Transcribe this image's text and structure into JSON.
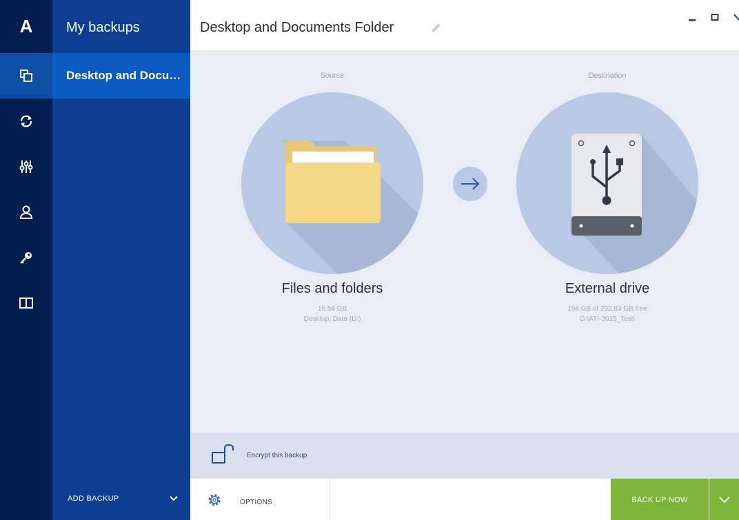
{
  "app": {
    "logo": "A"
  },
  "rail": {
    "items": [
      {
        "icon": "backup-icon",
        "active": true
      },
      {
        "icon": "sync-icon",
        "active": false
      },
      {
        "icon": "tools-icon",
        "active": false
      },
      {
        "icon": "account-icon",
        "active": false
      },
      {
        "icon": "key-icon",
        "active": false
      },
      {
        "icon": "book-icon",
        "active": false
      }
    ]
  },
  "sidebar": {
    "title": "My backups",
    "items": [
      {
        "label": "Desktop and Documents Folder"
      }
    ],
    "add_backup": "ADD BACKUP"
  },
  "header": {
    "title": "Desktop and Documents Folder",
    "controls": [
      "minimize-icon",
      "maximize-icon",
      "close-icon"
    ]
  },
  "source": {
    "heading": "Source",
    "title": "Files and folders",
    "size": "16.54 GB",
    "details": "Desktop, Data (D:)"
  },
  "destination": {
    "heading": "Destination",
    "title": "External drive",
    "space": "194 GB of 232.83 GB free",
    "path": "G:\\ATI-2015_Test\\"
  },
  "encrypt": {
    "label": "Encrypt this backup"
  },
  "toolbar": {
    "options": "OPTIONS",
    "backup_now": "BACK UP NOW"
  },
  "colors": {
    "rail": "#021d4f",
    "sidebar": "#0a3f94",
    "sidebar_active": "#0b5bc2",
    "accent_green": "#7cb53a",
    "circle": "#b7c9e3"
  }
}
